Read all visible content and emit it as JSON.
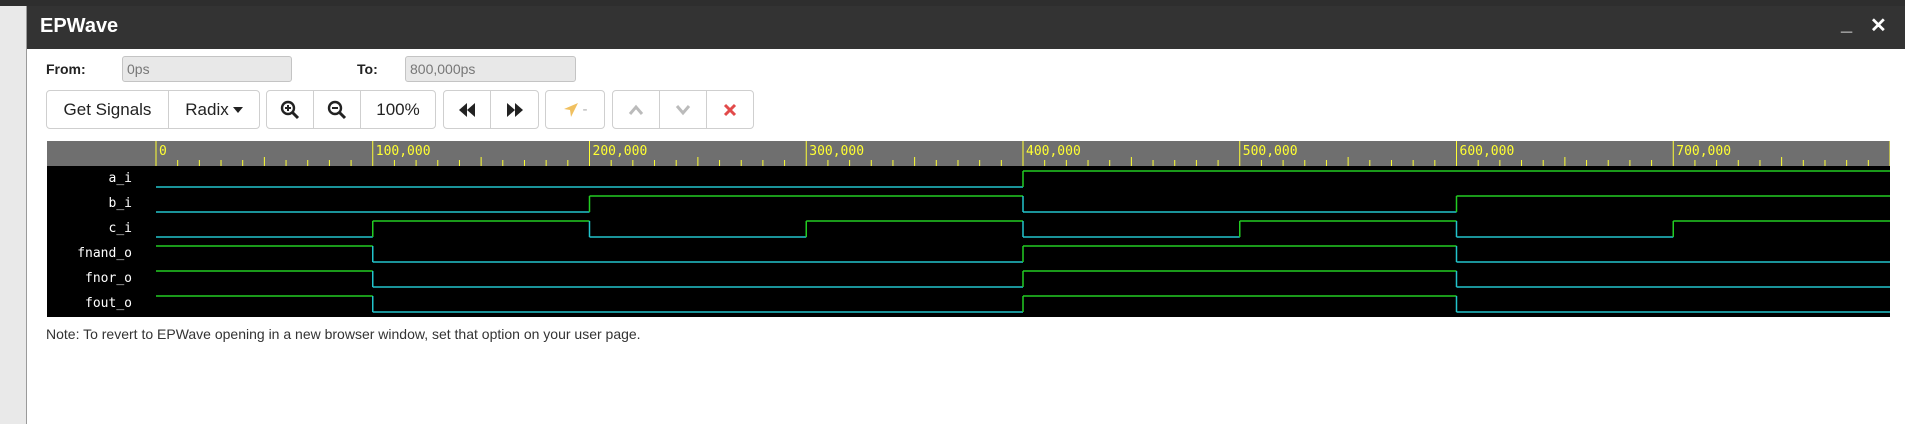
{
  "window": {
    "title": "EPWave",
    "minimize_label": "_",
    "close_label": "✕"
  },
  "range": {
    "from_label": "From:",
    "from_value": "0ps",
    "to_label": "To:",
    "to_value": "800,000ps"
  },
  "toolbar": {
    "get_signals_label": "Get Signals",
    "radix_label": "Radix",
    "zoom_level": "100%",
    "cursor_value": "-",
    "icons": [
      "zoom-in-icon",
      "zoom-out-icon",
      "rewind-icon",
      "fast-forward-icon",
      "cursor-arrow-icon",
      "chevron-up-icon",
      "chevron-down-icon",
      "close-x-icon"
    ]
  },
  "colors": {
    "wave_bg": "#000000",
    "ruler_bg": "#6f6f6f",
    "ruler_text": "#ffff33",
    "signal_green": "#22cc22",
    "signal_cyan": "#22c4cc",
    "delete_red": "#e24a4a"
  },
  "ruler": {
    "tick_labels": [
      "0",
      "100,000",
      "200,000",
      "300,000",
      "400,000",
      "500,000",
      "600,000",
      "700,000"
    ]
  },
  "signals": [
    {
      "name": "a_i",
      "transitions": [
        [
          0,
          0
        ],
        [
          400000,
          1
        ]
      ]
    },
    {
      "name": "b_i",
      "transitions": [
        [
          0,
          0
        ],
        [
          200000,
          1
        ],
        [
          400000,
          0
        ],
        [
          600000,
          1
        ]
      ]
    },
    {
      "name": "c_i",
      "transitions": [
        [
          0,
          0
        ],
        [
          100000,
          1
        ],
        [
          200000,
          0
        ],
        [
          300000,
          1
        ],
        [
          400000,
          0
        ],
        [
          500000,
          1
        ],
        [
          600000,
          0
        ],
        [
          700000,
          1
        ]
      ]
    },
    {
      "name": "fnand_o",
      "transitions": [
        [
          0,
          1
        ],
        [
          100000,
          0
        ],
        [
          400000,
          1
        ],
        [
          600000,
          0
        ]
      ]
    },
    {
      "name": "fnor_o",
      "transitions": [
        [
          0,
          1
        ],
        [
          100000,
          0
        ],
        [
          400000,
          1
        ],
        [
          600000,
          0
        ]
      ]
    },
    {
      "name": "fout_o",
      "transitions": [
        [
          0,
          1
        ],
        [
          100000,
          0
        ],
        [
          400000,
          1
        ],
        [
          600000,
          0
        ]
      ]
    }
  ],
  "time_range": [
    0,
    800000
  ],
  "note": "Note: To revert to EPWave opening in a new browser window, set that option on your user page."
}
